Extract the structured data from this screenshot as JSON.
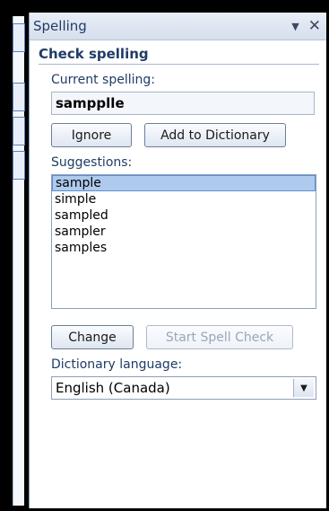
{
  "pane": {
    "title": "Spelling",
    "dropdown_icon": "▼",
    "close_icon": "✕"
  },
  "check": {
    "title": "Check spelling",
    "current_label": "Current spelling:",
    "current_value": "samppl​le",
    "ignore": "Ignore",
    "add": "Add to Dictionary",
    "suggestions_label": "Suggestions:",
    "suggestions": [
      "sample",
      "simple",
      "sampled",
      "sampler",
      "samples"
    ],
    "selected_index": 0,
    "change": "Change",
    "start": "Start Spell Check",
    "language_label": "Dictionary language:",
    "language_value": "English (Canada)",
    "language_arrow": "▼"
  },
  "colors": {
    "accent": "#1f3c66",
    "selection": "#aecbed"
  }
}
